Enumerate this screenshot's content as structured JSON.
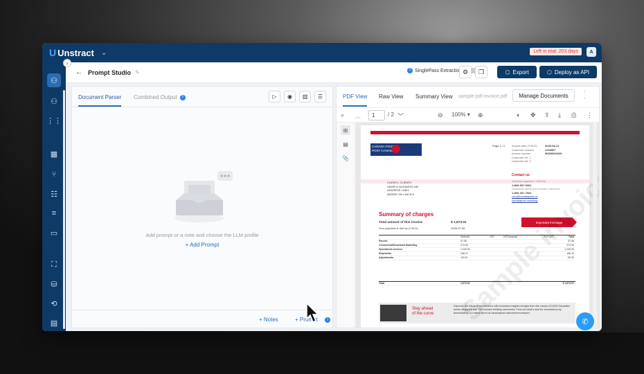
{
  "app": {
    "name": "Unstract",
    "trial": "Left in trial: 203 days",
    "avatar": "A"
  },
  "header": {
    "title": "Prompt Studio",
    "singlepass_label": "SinglePass Extraction",
    "export_label": "Export",
    "deploy_label": "Deploy as API"
  },
  "left_panel": {
    "tabs": [
      "Document Parser",
      "Combined Output"
    ],
    "empty_text": "Add prompt or a note and choose the LLM profile",
    "add_prompt": "+ Add Prompt",
    "notes": "+ Notes",
    "prompt": "+ Prompt"
  },
  "right_panel": {
    "tabs": [
      "PDF View",
      "Raw View",
      "Summary View"
    ],
    "filename": "sample-pdf-invoice.pdf",
    "manage_documents": "Manage Documents",
    "page_input": "1",
    "page_total": "/ 2",
    "zoom": "100%"
  },
  "invoice": {
    "logo_line1": "CANADA   POSTES",
    "logo_line2": "POST      CANADA",
    "page_label": "Page 1 / 2",
    "meta_labels": [
      "Invoice date (Y-M-D)",
      "Customer number",
      "Invoice number",
      "Customer ref. 1",
      "Customer ref. 2"
    ],
    "meta_values": [
      "2025-06-21",
      "1234567",
      "90000001620",
      "",
      ""
    ],
    "contact_title": "Contact us",
    "contact_lines": [
      "General enquiries / Toll-free",
      "1-866-607-6301",
      "Questions about your invoice / account",
      "1-800-267-7651",
      "cms@canadapost.ca",
      "canadapost.ca/billing"
    ],
    "address": [
      "CLIENT1, CLIENT2",
      "SAMPLE BUSINESS NM",
      "ADDRESS LINE1",
      "BARRIE ON L4M 3C2"
    ],
    "summary_title": "Summary of charges",
    "total_amount_label": "Total amount of this invoice",
    "total_amount": "$ 1,673.01",
    "due_label": "Your payment is due by (Y-M-D)",
    "due_date": "2025-07-06",
    "important": "Important message",
    "table_headers": [
      "Subtotal",
      "GST",
      "HST(sepcial)",
      "PST/QST",
      "Total"
    ],
    "table_rows": [
      [
        "Parcels",
        "97.98",
        "",
        "",
        "",
        "97.98"
      ],
      [
        "Commercial/Smartmail Marketing",
        "274.90",
        "",
        "",
        "",
        "274.90"
      ],
      [
        "Specialized services",
        "1,240.00",
        "",
        "",
        "",
        "1,240.00"
      ],
      [
        "Shipments",
        "166.13",
        "",
        "",
        "",
        "166.13"
      ],
      [
        "Adjustments",
        "-50.00",
        "",
        "",
        "",
        "-50.00"
      ]
    ],
    "total_row": [
      "Total",
      "1,673.01",
      "",
      "",
      "",
      "$ 1,673.01"
    ],
    "banner_title_1": "Stay ahead",
    "banner_title_2": "of the curve",
    "banner_text": "Discover the future of ecommerce with exclusive insights straight from the voices of 5,000 Canadian online shoppers and 755 forward-thinking merchants. Find out what's next for ecommerce by downloading our latest report at canadapost.ca/ecommercereport",
    "watermark": "Sample invoice"
  }
}
